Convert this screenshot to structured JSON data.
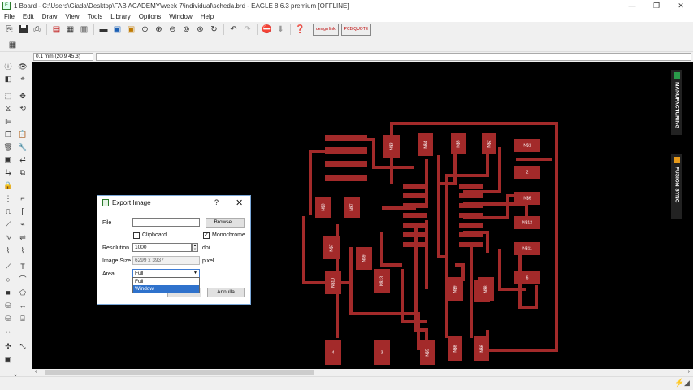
{
  "window": {
    "title": "1 Board - C:\\Users\\Giada\\Desktop\\FAB ACADEMY\\week 7\\individual\\scheda.brd - EAGLE 8.6.3 premium [OFFLINE]",
    "minimize": "—",
    "maximize": "❐",
    "close": "✕"
  },
  "menu": [
    "File",
    "Edit",
    "Draw",
    "View",
    "Tools",
    "Library",
    "Options",
    "Window",
    "Help"
  ],
  "toolbar": {
    "design_link": "design link",
    "pcb_quote": "PCB QUOTE"
  },
  "coord": "0.1 mm (20.9 45.3)",
  "side_tabs": {
    "manufacturing": "MANUFACTURING",
    "fusion_sync": "FUSION SYNC"
  },
  "board": {
    "trace_color": "#a32a2a",
    "labels": [
      "N$3",
      "N$4",
      "N$5",
      "N$2",
      "N$1",
      "2",
      "N$6",
      "N$12",
      "N$11",
      "N$3",
      "N$7",
      "N$7",
      "N$10",
      "N$9",
      "N$13",
      "N$9",
      "N$8",
      "N$10",
      "6",
      "4",
      "3",
      "N$5",
      "N$8",
      "N$6"
    ]
  },
  "dialog": {
    "title": "Export Image",
    "help": "?",
    "close": "✕",
    "file_label": "File",
    "file_value": "",
    "browse": "Browse...",
    "clipboard": "Clipboard",
    "clipboard_checked": false,
    "monochrome": "Monochrome",
    "monochrome_checked": true,
    "resolution_label": "Resolution",
    "resolution_value": "1000",
    "resolution_unit": "dpi",
    "image_size_label": "Image Size",
    "image_size_value": "6299 x 3937",
    "image_size_unit": "pixel",
    "area_label": "Area",
    "area_value": "Full",
    "area_options": [
      "Full",
      "Window"
    ],
    "area_highlighted": "Window",
    "ok": "OK",
    "cancel": "Annulla"
  }
}
